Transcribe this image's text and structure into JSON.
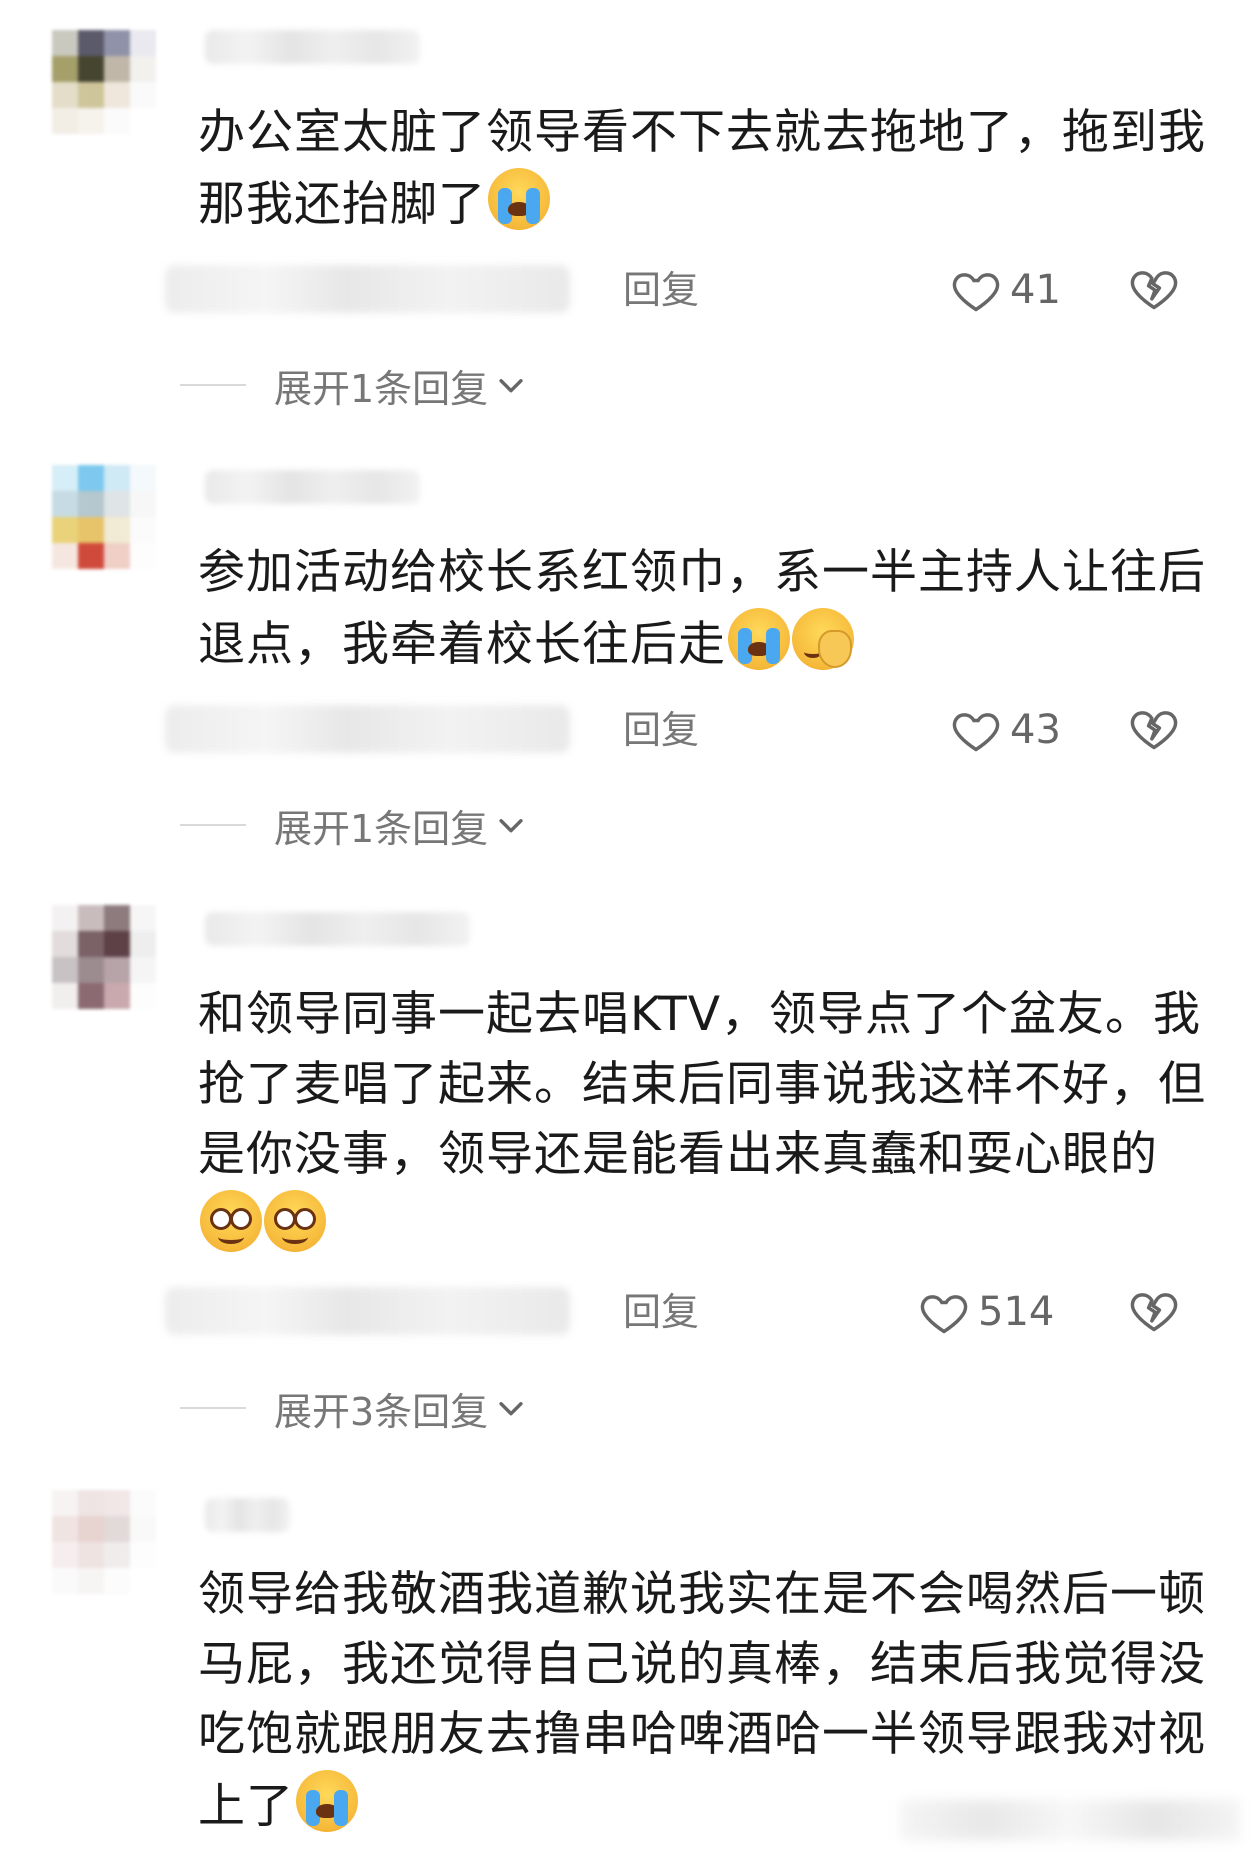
{
  "comments": [
    {
      "text": "办公室太脏了领导看不下去就去拖地了，拖到我那我还抬脚了",
      "emojis": [
        "cry"
      ],
      "reply_label": "回复",
      "likes": "41",
      "expand_label": "展开1条回复"
    },
    {
      "text": "参加活动给校长系红领巾，系一半主持人让往后退点，我牵着校长往后走",
      "emojis": [
        "cry",
        "facepalm"
      ],
      "reply_label": "回复",
      "likes": "43",
      "expand_label": "展开1条回复"
    },
    {
      "text": "和领导同事一起去唱KTV，领导点了个盆友。我抢了麦唱了起来。结束后同事说我这样不好，但是你没事，领导还是能看出来真蠢和耍心眼的",
      "emojis": [
        "smile",
        "smile"
      ],
      "reply_label": "回复",
      "likes": "514",
      "expand_label": "展开3条回复"
    },
    {
      "text": "领导给我敬酒我道歉说我实在是不会喝然后一顿马屁，我还觉得自己说的真棒，结束后我觉得没吃饱就跟朋友去撸串哈啤酒哈一半领导跟我对视上了",
      "emojis": [
        "cry"
      ]
    }
  ],
  "icons": {
    "like": "heart-outline-icon",
    "dislike": "broken-heart-icon",
    "expand": "chevron-down-icon"
  },
  "colors": {
    "text": "#1a1a1a",
    "secondary": "#777777",
    "background": "#ffffff"
  }
}
